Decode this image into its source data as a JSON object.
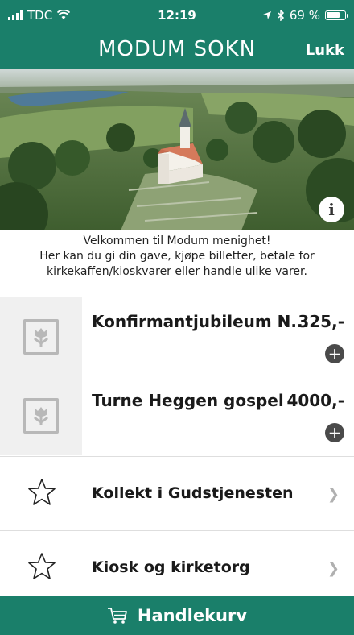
{
  "status_bar": {
    "carrier": "TDC",
    "time": "12:19",
    "battery": "69 %"
  },
  "header": {
    "title": "MODUM SOKN",
    "close_label": "Lukk"
  },
  "hero": {
    "info_label": "i"
  },
  "welcome": {
    "line1": "Velkommen til Modum menighet!",
    "line2": "Her kan du gi din gave, kjøpe billetter, betale for",
    "line3": "kirkekaffen/kioskvarer eller handle ulike varer."
  },
  "products": [
    {
      "name": "Konfirmantjubileum N...",
      "price": "325,-"
    },
    {
      "name": "Turne Heggen gospel",
      "price": "4000,-"
    }
  ],
  "categories": [
    {
      "name": "Kollekt i Gudstjenesten"
    },
    {
      "name": "Kiosk og kirketorg"
    }
  ],
  "cart": {
    "label": "Handlekurv"
  },
  "colors": {
    "brand": "#1a7f6a"
  }
}
